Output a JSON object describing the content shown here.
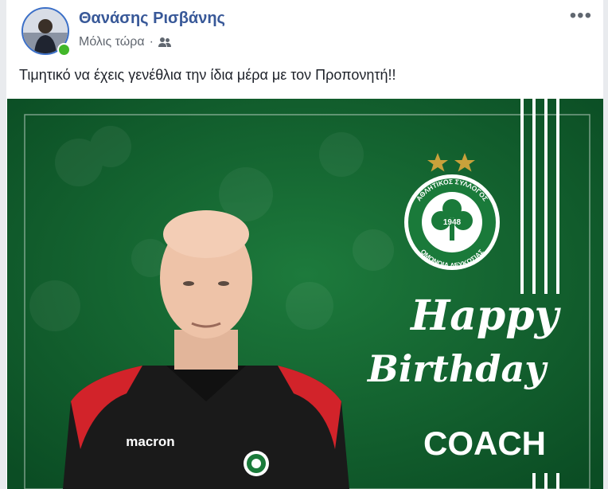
{
  "post": {
    "author": "Θανάσης Ρισβάνης",
    "timestamp": "Μόλις τώρα",
    "separator": "·",
    "audience_icon": "friends-icon",
    "menu_icon": "more-options-icon",
    "message": "Τιμητικό να έχεις γενέθλια την ίδια μέρα με τον Προπονητή!!"
  },
  "photo": {
    "greeting_line1": "Happy",
    "greeting_line2": "Birthday",
    "greeting_line3": "COACH",
    "badge_text_top": "ΑΘΛΗΤΙΚΟΣ ΣΥΛΛΟΓΟΣ",
    "badge_text_bottom": "ΟΜΟΝΟΙΑ ΛΕΥΚΩΣΙΑΣ",
    "badge_year": "1948",
    "shirt_brand": "macron",
    "colors": {
      "background": "#0e5a2c",
      "accent_green": "#1a7a3a",
      "text_white": "#ffffff",
      "star_gold": "#c9a13b",
      "shirt_red": "#d2232a",
      "shirt_black": "#1a1a1a"
    }
  }
}
